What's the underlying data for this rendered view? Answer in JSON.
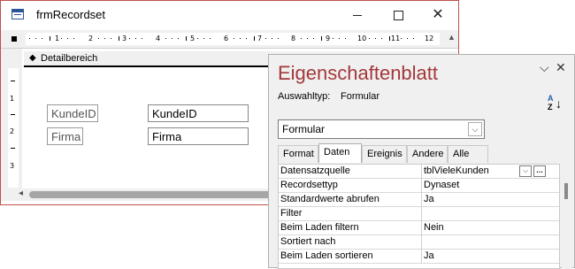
{
  "window": {
    "title": "frmRecordset",
    "close_glyph": "✕"
  },
  "ruler": {
    "numbers": [
      "1",
      "2",
      "3",
      "4",
      "5",
      "6",
      "7",
      "8",
      "9",
      "10",
      "11",
      "12"
    ],
    "vertical_numbers": [
      "1",
      "2",
      "3"
    ]
  },
  "section": {
    "label": "Detailbereich"
  },
  "controls": {
    "label1": "KundeID",
    "text1": "KundeID",
    "label2": "Firma",
    "text2": "Firma"
  },
  "property_sheet": {
    "title": "Eigenschaftenblatt",
    "selection_type_label": "Auswahltyp:",
    "selection_type_value": "Formular",
    "object_select": "Formular",
    "tabs": [
      "Format",
      "Daten",
      "Ereignis",
      "Andere",
      "Alle"
    ],
    "active_tab": "Daten",
    "properties": [
      {
        "name": "Datensatzquelle",
        "value": "tblVieleKunden"
      },
      {
        "name": "Recordsettyp",
        "value": "Dynaset"
      },
      {
        "name": "Standardwerte abrufen",
        "value": "Ja"
      },
      {
        "name": "Filter",
        "value": ""
      },
      {
        "name": "Beim Laden filtern",
        "value": "Nein"
      },
      {
        "name": "Sortiert nach",
        "value": ""
      },
      {
        "name": "Beim Laden sortieren",
        "value": "Ja"
      }
    ]
  },
  "icons": {
    "app": "form-icon",
    "sort": "sort-az-icon"
  },
  "colors": {
    "window_border": "#c0504d",
    "title_accent": "#a4373a"
  }
}
